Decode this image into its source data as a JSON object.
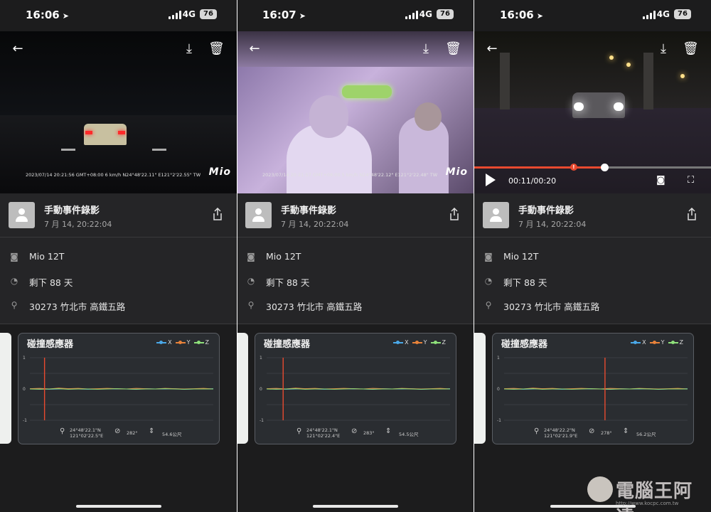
{
  "panels": [
    {
      "status": {
        "time": "16:06",
        "network": "4G",
        "battery": "76"
      },
      "video": {
        "overlay": "2023/07/14 20:21:56 GMT+08:00   6 km/h   N24°48'22.11\"  E121°2'22.55\"   TW",
        "logo": "Mio",
        "has_player": false
      },
      "event": {
        "title": "手動事件錄影",
        "time": "7 月 14, 20:22:04"
      },
      "details": {
        "device": "Mio 12T",
        "remaining": "剩下 88 天",
        "address": "30273 竹北市 高鐵五路"
      },
      "sensor": {
        "title": "碰撞感應器",
        "lat": "24°48'22.1\"N",
        "lon": "121°02'22.5\"E",
        "heading": "282°",
        "altitude": "54.6公尺",
        "cursor": 0.08
      }
    },
    {
      "status": {
        "time": "16:07",
        "network": "4G",
        "battery": "76"
      },
      "video": {
        "overlay": "2023/07/14 20:21:57 GMT+08:00   5 km/h   N24°48'22.12\"  E121°2'22.48\"   TW",
        "logo": "Mio",
        "has_player": false
      },
      "event": {
        "title": "手動事件錄影",
        "time": "7 月 14, 20:22:04"
      },
      "details": {
        "device": "Mio 12T",
        "remaining": "剩下 88 天",
        "address": "30273 竹北市 高鐵五路"
      },
      "sensor": {
        "title": "碰撞感應器",
        "lat": "24°48'22.1\"N",
        "lon": "121°02'22.4\"E",
        "heading": "283°",
        "altitude": "54.5公尺",
        "cursor": 0.09
      }
    },
    {
      "status": {
        "time": "16:06",
        "network": "4G",
        "battery": "76"
      },
      "video": {
        "overlay": "",
        "logo": "",
        "has_player": true,
        "timecode": "00:11/00:20",
        "progress": 0.55,
        "event_marker": 0.42
      },
      "event": {
        "title": "手動事件錄影",
        "time": "7 月 14, 20:22:04"
      },
      "details": {
        "device": "Mio 12T",
        "remaining": "剩下 88 天",
        "address": "30273 竹北市 高鐵五路"
      },
      "sensor": {
        "title": "碰撞感應器",
        "lat": "24°48'22.2\"N",
        "lon": "121°02'21.9\"E",
        "heading": "278°",
        "altitude": "56.2公尺",
        "cursor": 0.55
      }
    }
  ],
  "chart_data": {
    "type": "line",
    "legend": [
      "X",
      "Y",
      "Z"
    ],
    "series_colors": {
      "X": "#4aa8e8",
      "Y": "#e8823a",
      "Z": "#8ee07a"
    },
    "ylim": [
      -1,
      1
    ],
    "yticks": [
      "1",
      "0",
      "-1"
    ],
    "series": [
      {
        "name": "X",
        "values": [
          0,
          0.01,
          -0.01,
          0,
          0.01,
          0,
          -0.01,
          0,
          0.01,
          0,
          0,
          -0.01,
          0.01,
          0,
          0,
          0.01,
          -0.01,
          0,
          0,
          0.01
        ]
      },
      {
        "name": "Y",
        "values": [
          0.01,
          0.02,
          0,
          0.03,
          0.01,
          0.02,
          0,
          0.01,
          0.02,
          0.01,
          0,
          0.02,
          0.01,
          0,
          0.02,
          0.01,
          0,
          0.01,
          0.02,
          0
        ]
      },
      {
        "name": "Z",
        "values": [
          0,
          -0.01,
          0,
          0.01,
          -0.01,
          0,
          0,
          -0.01,
          0,
          0.01,
          0,
          -0.01,
          0,
          0,
          0.01,
          0,
          -0.01,
          0,
          0,
          0
        ]
      }
    ]
  },
  "colors": {
    "accent": "#e84a2f",
    "background": "#1f1f20",
    "card": "#2a2d31"
  },
  "watermark": {
    "text": "電腦王阿達",
    "url": "http://www.kocpc.com.tw"
  }
}
